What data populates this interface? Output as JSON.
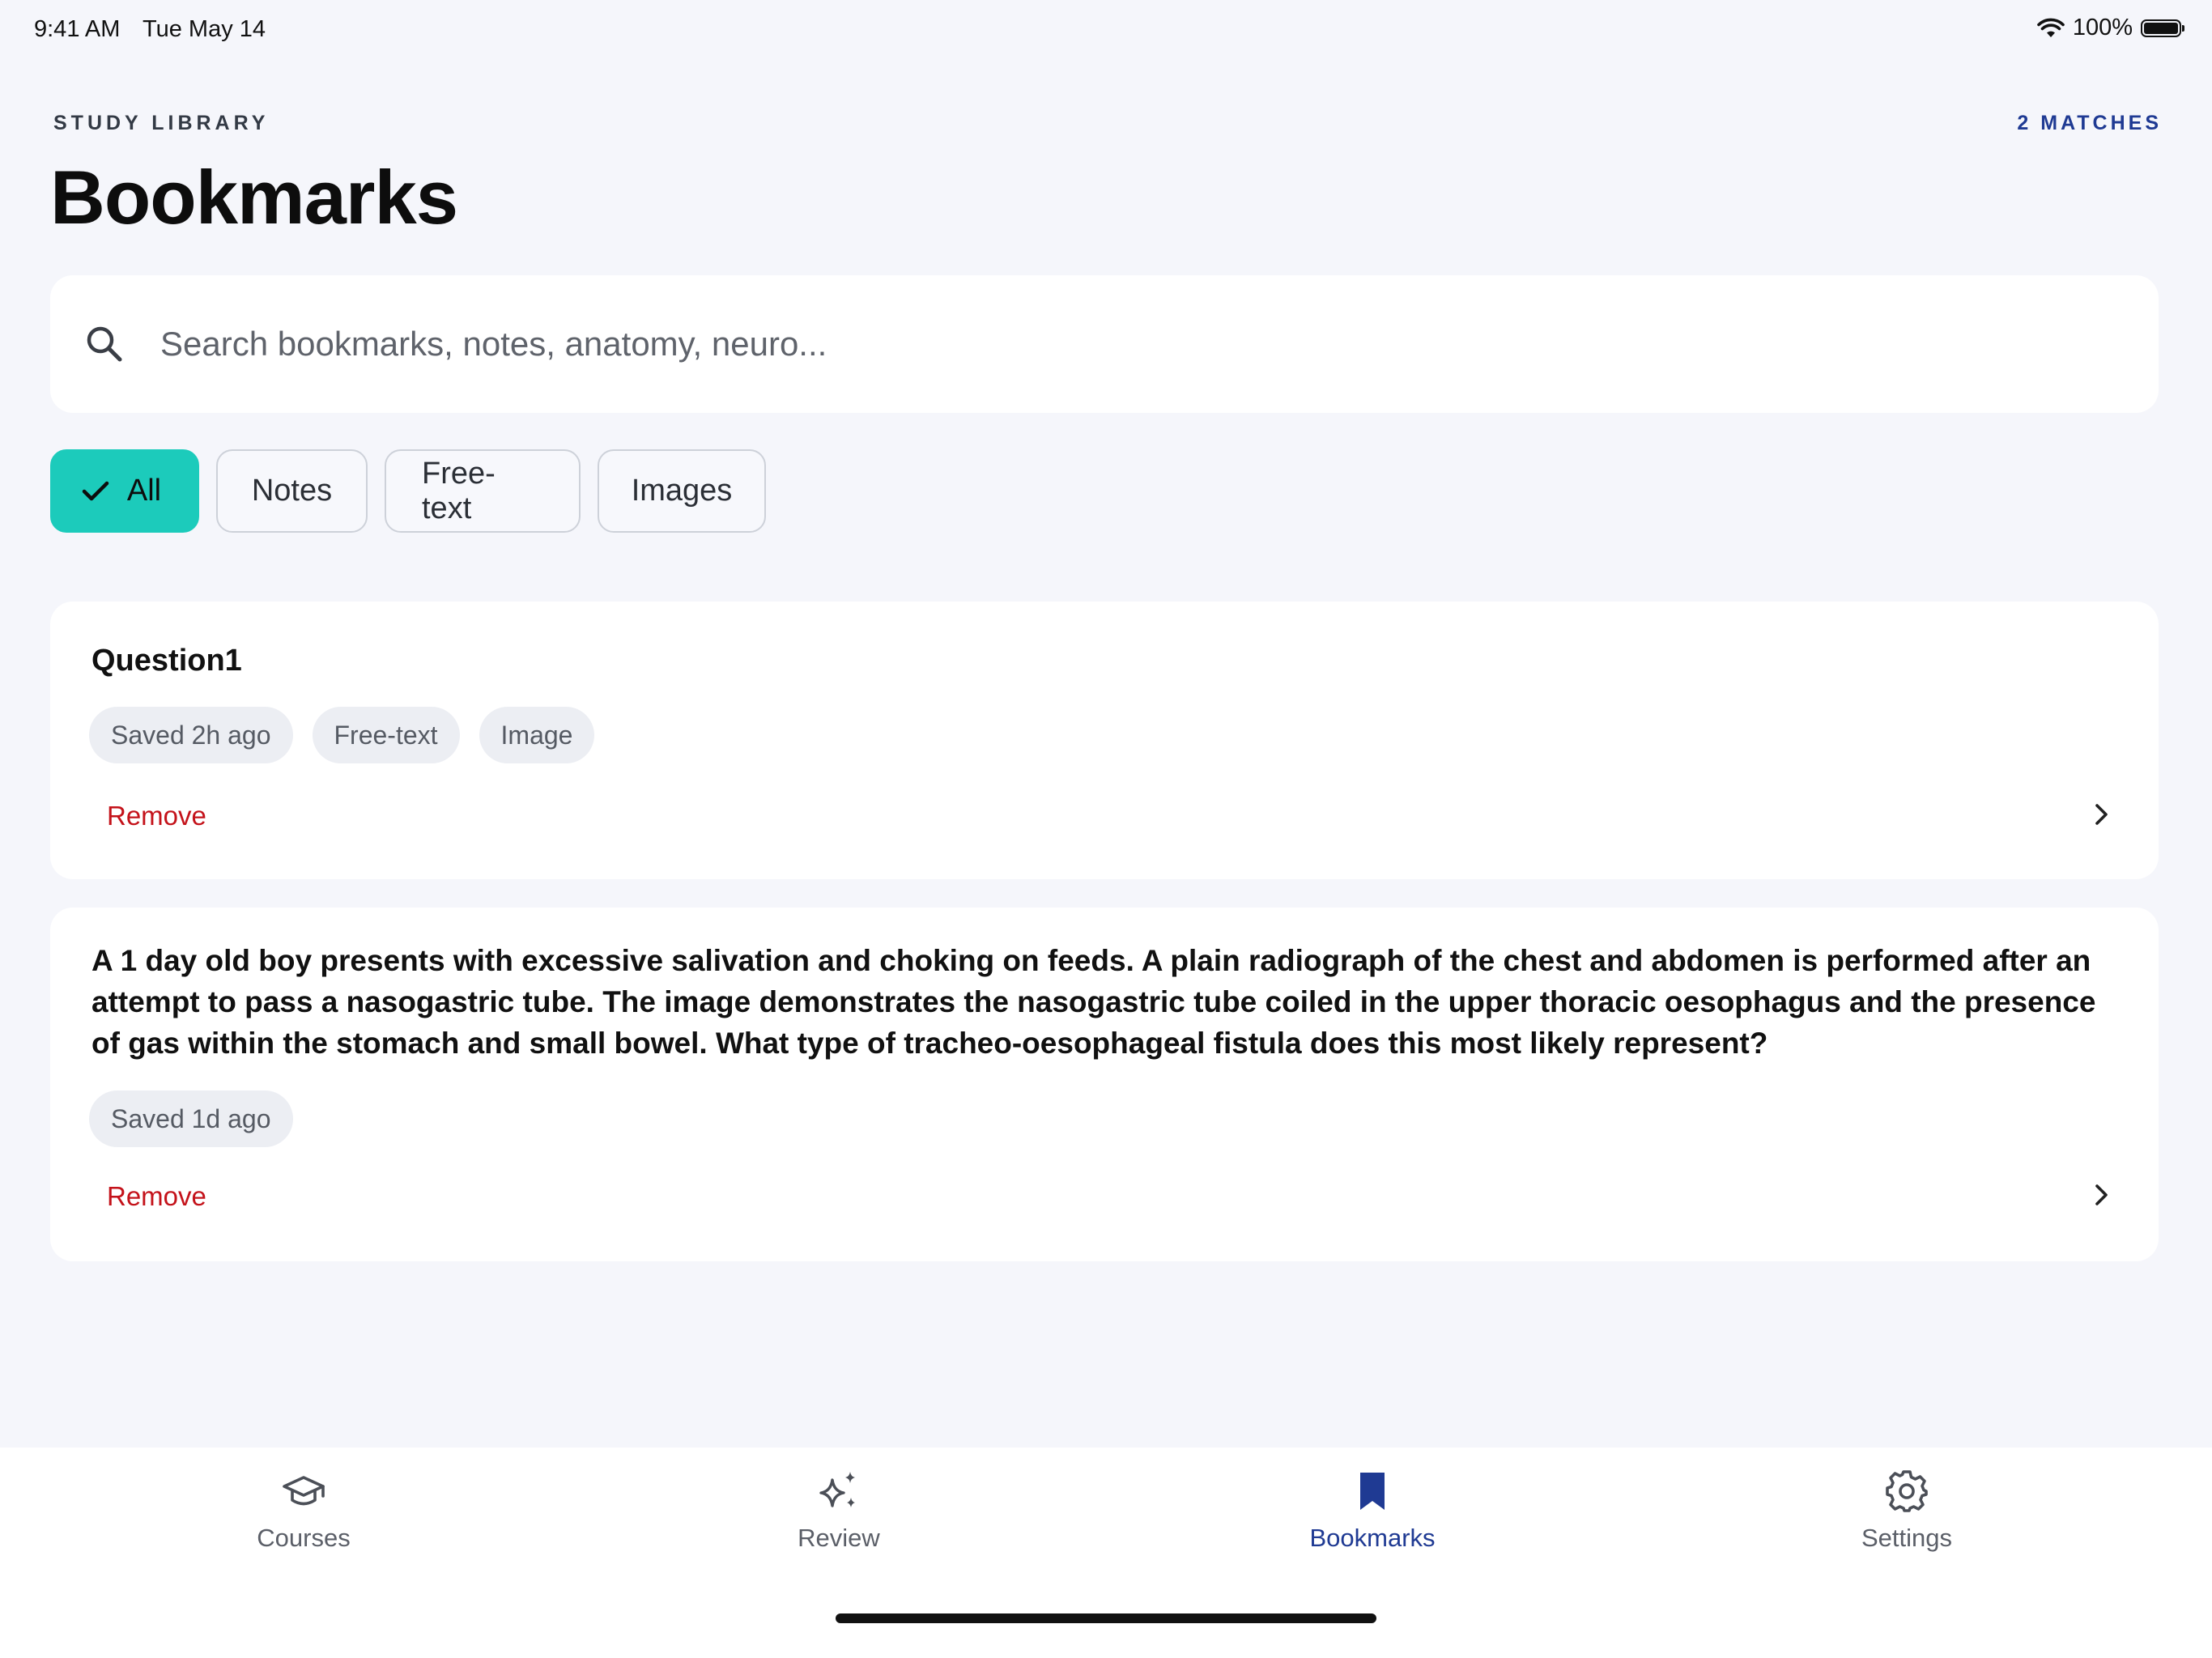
{
  "status_bar": {
    "time": "9:41 AM",
    "date": "Tue May 14",
    "battery": "100%",
    "battery_level": 1.0
  },
  "header": {
    "eyebrow": "STUDY LIBRARY",
    "title": "Bookmarks",
    "matches": "2 MATCHES"
  },
  "search": {
    "placeholder": "Search bookmarks, notes, anatomy, neuro..."
  },
  "filters": {
    "all": "All",
    "notes": "Notes",
    "free_text": "Free-text",
    "images": "Images",
    "selected": "All"
  },
  "bookmarks": [
    {
      "title": "Question1",
      "tags": [
        "Saved 2h ago",
        "Free-text",
        "Image"
      ],
      "remove_label": "Remove"
    },
    {
      "text": "A 1 day old boy presents with excessive salivation and choking on feeds. A plain radiograph of the chest and abdomen is performed after an attempt to pass a nasogastric tube. The image demonstrates the nasogastric tube coiled in the upper thoracic oesophagus and the presence of gas within the stomach and small bowel. What type of tracheo-oesophageal fistula does this most likely represent?",
      "tags": [
        "Saved 1d ago"
      ],
      "remove_label": "Remove"
    }
  ],
  "tabbar": {
    "courses": "Courses",
    "review": "Review",
    "bookmarks": "Bookmarks",
    "settings": "Settings",
    "active": "Bookmarks"
  },
  "colors": {
    "accent_teal": "#1ccbbb",
    "brand_navy": "#1f3a93",
    "danger_red": "#c4121a",
    "background": "#f5f6fb"
  },
  "icons": {
    "search": "search-icon",
    "check": "checkmark-icon",
    "chevron": "chevron-right-icon",
    "courses": "graduation-cap-icon",
    "review": "sparkles-icon",
    "bookmarks": "bookmark-icon",
    "settings": "gear-icon",
    "wifi": "wifi-icon",
    "battery": "battery-icon"
  }
}
